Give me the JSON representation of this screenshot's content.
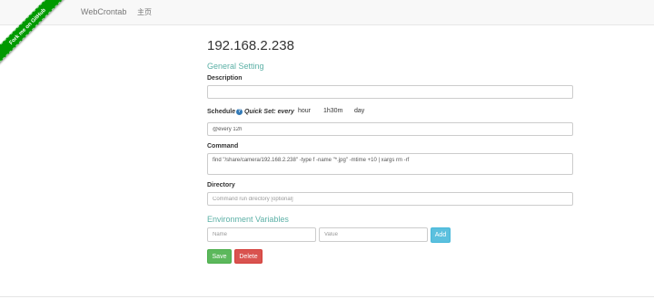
{
  "navbar": {
    "brand": "WebCrontab",
    "home": "主页",
    "ribbon": "Fork me on GitHub"
  },
  "page": {
    "title": "192.168.2.238"
  },
  "general": {
    "section_title": "General Setting",
    "description_label": "Description",
    "description_value": "",
    "schedule_label": "Schedule",
    "quickset_label": "Quick Set: every",
    "quick_options": [
      "hour",
      "1h30m",
      "day"
    ],
    "schedule_value": "@every 12h",
    "command_label": "Command",
    "command_value": "find \"/share/camera/192.168.2.238\" -type f -name \"*.jpg\" -mtime +10 | xargs rm -rf",
    "directory_label": "Directory",
    "directory_placeholder": "Command run directory [optional]"
  },
  "env": {
    "section_title": "Environment Variables",
    "name_placeholder": "Name",
    "value_placeholder": "Value",
    "add_label": "Add"
  },
  "actions": {
    "save_label": "Save",
    "delete_label": "Delete"
  },
  "colors": {
    "section_title": "#5bb0a6",
    "ribbon": "#009900",
    "add": "#5bc0de",
    "save": "#5cb85c",
    "delete": "#d9534f"
  },
  "icons": {
    "help": "question-circle-icon"
  }
}
